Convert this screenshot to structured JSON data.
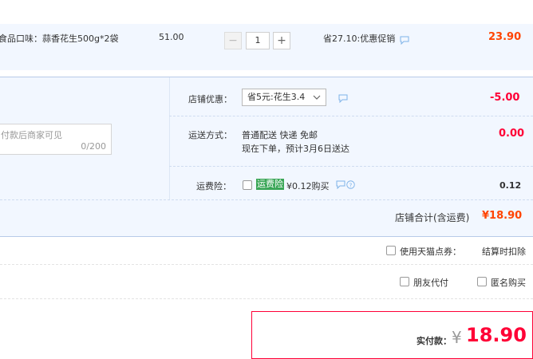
{
  "item": {
    "description": "食品口味：蒜香花生500g*2袋",
    "unit_price": "51.00",
    "quantity": "1",
    "minus_label": "−",
    "plus_label": "+",
    "promo": "省27.10:优惠促销",
    "subtotal": "23.90"
  },
  "shop": {
    "discount_label": "店铺优惠：",
    "discount_select": "省5元:花生3.4",
    "discount_amount": "-5.00",
    "message_placeholder": "付款后商家可见",
    "message_count": "0/200",
    "shipping_label": "运送方式：",
    "shipping_method": "普通配送 快递 免邮",
    "shipping_note": "现在下单，预计3月6日送达",
    "shipping_amount": "0.00",
    "insurance_label": "运费险：",
    "insurance_tag": "运费险",
    "insurance_price": "¥0.12购买",
    "insurance_amount": "0.12",
    "total_label": "店铺合计(含运费)",
    "total_amount": "¥18.90"
  },
  "options": {
    "tmall_points_label": "使用天猫点券：",
    "tmall_points_note": "结算时扣除",
    "friend_pay_label": "朋友代付",
    "anonymous_label": "匿名购买"
  },
  "payment": {
    "label": "实付款：",
    "currency": "¥",
    "amount": "18.90"
  },
  "colors": {
    "accent_orange": "#ff4400",
    "accent_red": "#ff0036",
    "panel_blue": "#f2f7ff",
    "insurance_green": "#3aa657"
  }
}
